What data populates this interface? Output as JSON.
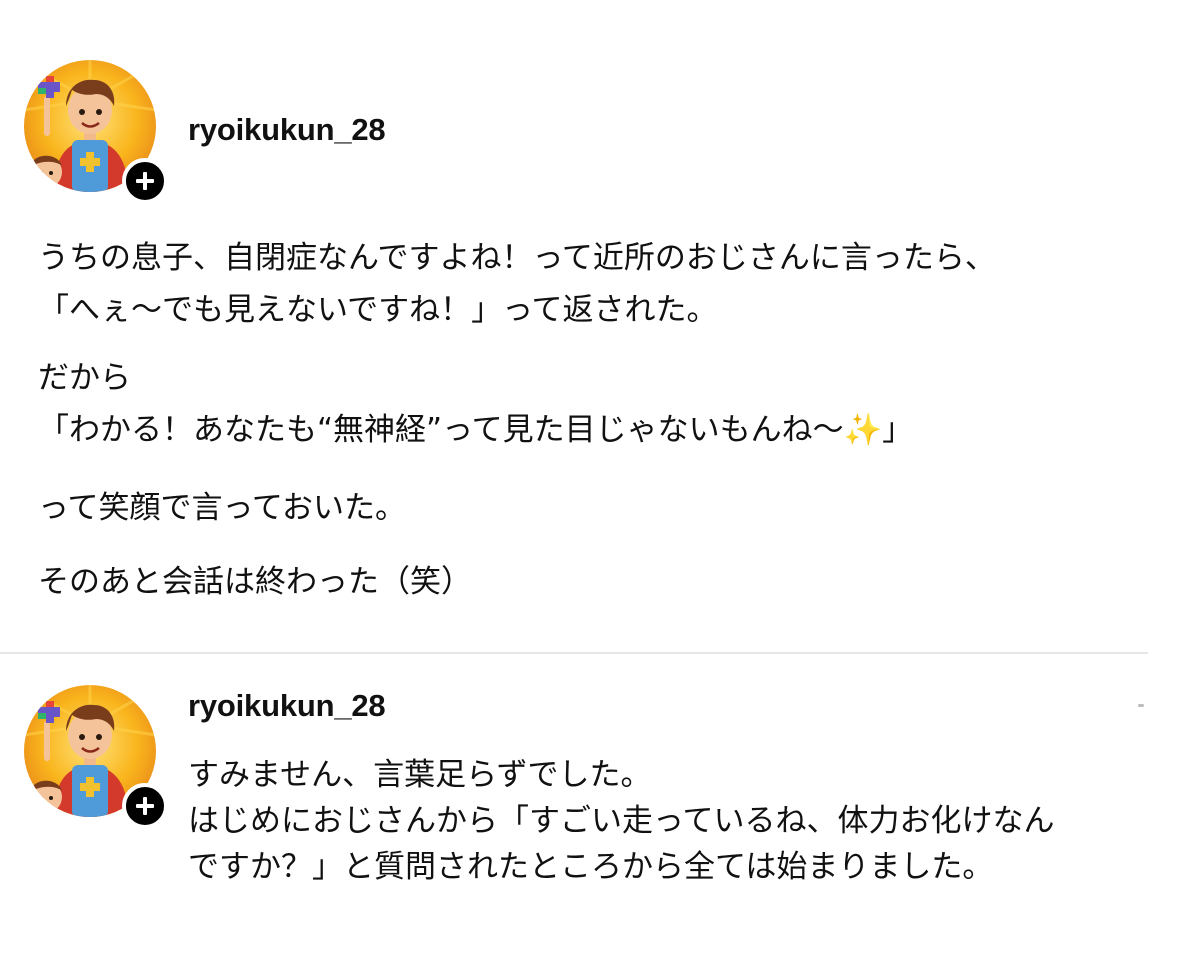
{
  "post": {
    "username": "ryoikukun_28",
    "paragraphs": [
      "うちの息子、自閉症なんですよね！って近所のおじさんに言ったら、\n「へぇ〜でも見えないですね！」って返された。",
      "だから\n「わかる！あなたも“無神経”って見た目じゃないもんね〜✨」",
      "って笑顔で言っておいた。",
      "そのあと会話は終わった（笑）"
    ]
  },
  "reply": {
    "username": "ryoikukun_28",
    "lines": [
      "すみません、言葉足らずでした。",
      "はじめにおじさんから「すごい走っているね、体力お化けなん\nですか？」と質問されたところから全ては始まりました。"
    ]
  },
  "colors": {
    "text": "#111111",
    "badge": "#000000",
    "divider": "#e6e6e6",
    "avatar_bg": "#f7b21a"
  },
  "icons": {
    "avatar": "superhero-boy-puzzle-avatar",
    "follow": "plus-icon",
    "more": "more-icon"
  }
}
